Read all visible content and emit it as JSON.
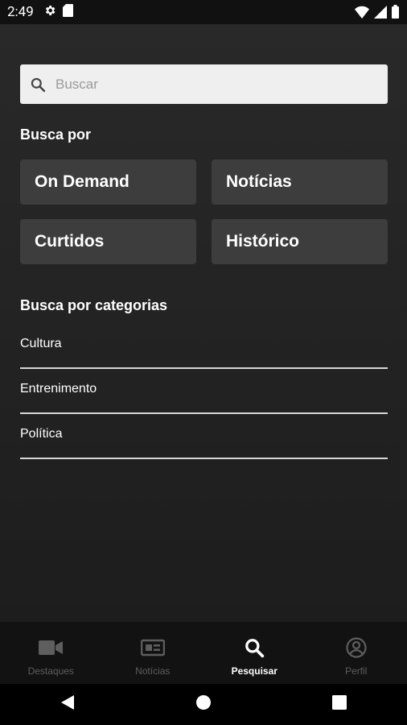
{
  "status_bar": {
    "time": "2:49"
  },
  "search": {
    "placeholder": "Buscar"
  },
  "busca_por": {
    "title": "Busca por",
    "tiles": [
      "On Demand",
      "Notícias",
      "Curtidos",
      "Histórico"
    ]
  },
  "categorias": {
    "title": "Busca por categorias",
    "items": [
      "Cultura",
      "Entrenimento",
      "Política"
    ]
  },
  "bottom_nav": {
    "items": [
      {
        "label": "Destaques",
        "icon": "video-camera-icon",
        "active": false
      },
      {
        "label": "Notícias",
        "icon": "newspaper-icon",
        "active": false
      },
      {
        "label": "Pesquisar",
        "icon": "search-icon",
        "active": true
      },
      {
        "label": "Perfil",
        "icon": "account-circle-icon",
        "active": false
      }
    ]
  },
  "colors": {
    "background": "#1e1e1e",
    "tile": "#3d3d3d",
    "search_bg": "#efefef",
    "nav_inactive": "#5e5e5e"
  }
}
